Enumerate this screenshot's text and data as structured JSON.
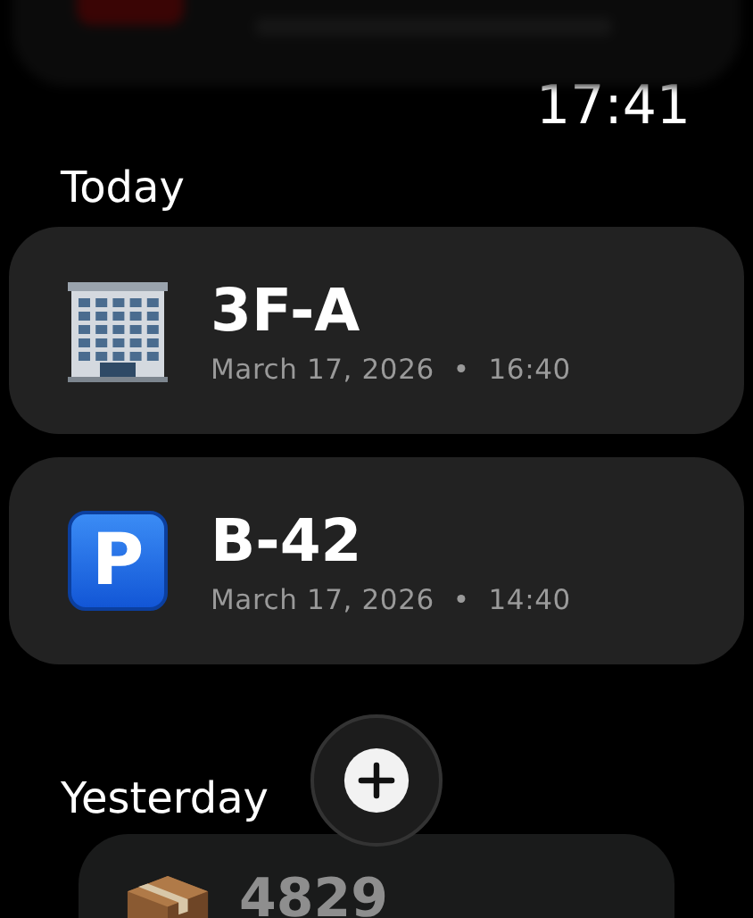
{
  "clock": "17:41",
  "sections": [
    {
      "title": "Today",
      "items": [
        {
          "kind": "building",
          "title": "3F-A",
          "subtitle": "March 17, 2026  •  16:40",
          "dimmed": false
        },
        {
          "kind": "parking",
          "icon_text": "P",
          "title": "B-42",
          "subtitle": "March 17, 2026  •  14:40",
          "dimmed": false
        }
      ]
    },
    {
      "title": "Yesterday",
      "items": [
        {
          "kind": "package",
          "title": "4829",
          "dimmed": true
        }
      ]
    }
  ]
}
